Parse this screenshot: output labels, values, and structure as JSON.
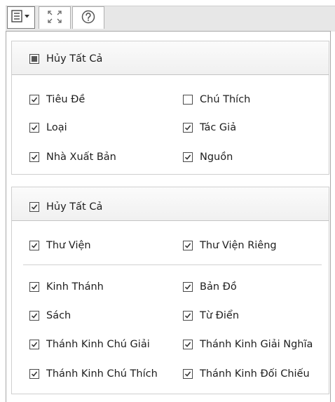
{
  "panel1": {
    "header": "Hủy Tất Cả",
    "items": [
      {
        "label": "Tiêu Đề",
        "checked": true
      },
      {
        "label": "Chú Thích",
        "checked": false
      },
      {
        "label": "Loại",
        "checked": true
      },
      {
        "label": "Tác Giả",
        "checked": true
      },
      {
        "label": "Nhà Xuất Bản",
        "checked": true
      },
      {
        "label": "Nguồn",
        "checked": true
      }
    ]
  },
  "panel2": {
    "header": "Hủy Tất Cả",
    "items": [
      {
        "label": "Thư Viện",
        "checked": true
      },
      {
        "label": "Thư Viện Riêng",
        "checked": true
      },
      {
        "label": "Kinh Thánh",
        "checked": true
      },
      {
        "label": "Bản Đồ",
        "checked": true
      },
      {
        "label": "Sách",
        "checked": true
      },
      {
        "label": "Từ Điển",
        "checked": true
      },
      {
        "label": "Thánh Kinh Chú Giải",
        "checked": true
      },
      {
        "label": "Thánh Kinh Giải Nghĩa",
        "checked": true
      },
      {
        "label": "Thánh Kinh Chú Thích",
        "checked": true
      },
      {
        "label": "Thánh Kinh Đối Chiếu",
        "checked": true
      }
    ]
  },
  "toolbar": {
    "menu_icon": "list-menu-icon",
    "expand_icon": "expand-arrows-icon",
    "help_icon": "help-circle-icon"
  }
}
